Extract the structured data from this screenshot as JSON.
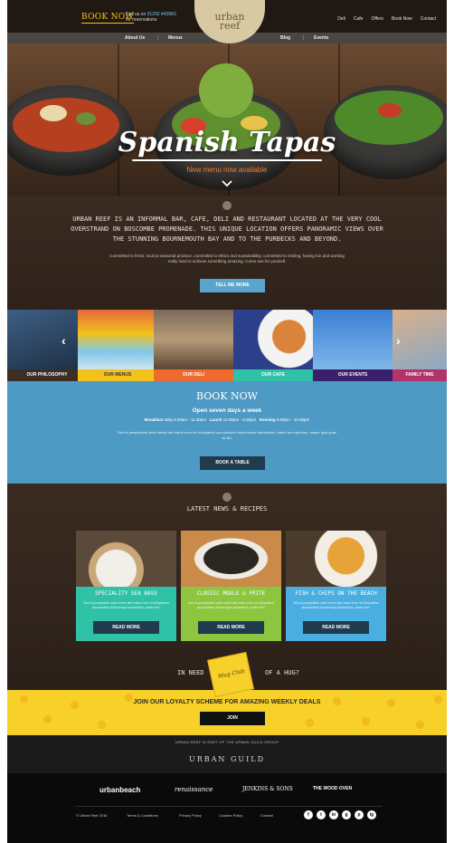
{
  "header": {
    "book_now": "BOOK NOW",
    "call_us_prefix": "Call us on",
    "call_us_number": "01202 443960",
    "call_us_suffix": "for reservations",
    "logo_line1": "urban",
    "logo_line2": "reef",
    "nav_right": [
      "Deli",
      "Cafe",
      "Offers",
      "Book Now",
      "Contact"
    ],
    "subnav": [
      "About Us",
      "Menus",
      "Blog",
      "Events"
    ]
  },
  "hero": {
    "title": "Spanish Tapas",
    "subtitle": "New menu now available"
  },
  "intro": {
    "heading": "Urban Reef is an informal bar, cafe, deli and restaurant located at the very cool overstrand on Boscombe Promenade. This unique location offers panoramic views over the stunning Bournemouth Bay and to the Purbecks and beyond.",
    "body": "Committed to fresh, local & seasonal produce, committed to ethics and sustainability, committed to smiling, having fun and working really hard to achieve something amazing. Come see for yourself.",
    "button": "TELL ME MORE"
  },
  "tiles": [
    {
      "label": "OUR PHILOSOPHY",
      "color": "#3a2e25"
    },
    {
      "label": "OUR MENUS",
      "color": "#f2c21b"
    },
    {
      "label": "OUR DELI",
      "color": "#ee6a2f"
    },
    {
      "label": "OUR CAFE",
      "color": "#2fc2a6"
    },
    {
      "label": "OUR EVENTS",
      "color": "#3a1f6b"
    },
    {
      "label": "FAMILY TIME",
      "color": "#b3336b"
    }
  ],
  "book": {
    "title": "BOOK NOW",
    "open": "Open seven days a week",
    "breakfast_label": "Breakfast",
    "breakfast_hours": "daily 9.00am - 11.30am",
    "lunch_label": "Lunch",
    "lunch_hours": "12.00pm - 5.00pm",
    "evening_label": "Evening",
    "evening_hours": "6.00pm - 10.00pm",
    "text": "Sed ut perspiciatis unde omnis iste natus error sit voluptatem accusantium doloremque laudantium, totam rem aperiam, eaque ipsa quae ab illo.",
    "button": "BOOK A TABLE"
  },
  "news": {
    "title": "Latest News & Recipes",
    "cards": [
      {
        "title": "Speciality Sea Bass",
        "text": "Sed ut perspiciatis unde omnis iste natus error sit voluptatem accusantium doloremque laudantium, totam rem.",
        "button": "READ MORE",
        "color": "#2fc2a6"
      },
      {
        "title": "Classic Moule & Frite",
        "text": "Sed ut perspiciatis unde omnis iste natus error sit voluptatem accusantium doloremque laudantium, totam rem.",
        "button": "READ MORE",
        "color": "#8cc63f"
      },
      {
        "title": "Fish & Chips on the Beach",
        "text": "Sed ut perspiciatis unde omnis iste natus error sit voluptatem accusantium doloremque laudantium, totam rem.",
        "button": "READ MORE",
        "color": "#4aaee0"
      }
    ],
    "need_left": "In need",
    "need_right": "of a hug?",
    "mug_label": "Mug Club"
  },
  "loyalty": {
    "text": "JOIN OUR LOYALTY SCHEME FOR AMAZING WEEKLY DEALS",
    "button": "JOIN"
  },
  "guild": {
    "part_of": "URBAN REEF IS PART OF THE URBAN GUILD GROUP",
    "logo": "URBAN GUILD"
  },
  "footer": {
    "brands": [
      "urbanbeach",
      "renaissance",
      "JENKINS & SONS",
      "THE WOOD OVEN"
    ],
    "links": [
      "© Urban Reef 2016",
      "Terms & Conditions",
      "Privacy Policy",
      "Cookies Policy",
      "Contact"
    ],
    "social": [
      "f",
      "t",
      "in",
      "g",
      "p",
      "ig"
    ]
  }
}
